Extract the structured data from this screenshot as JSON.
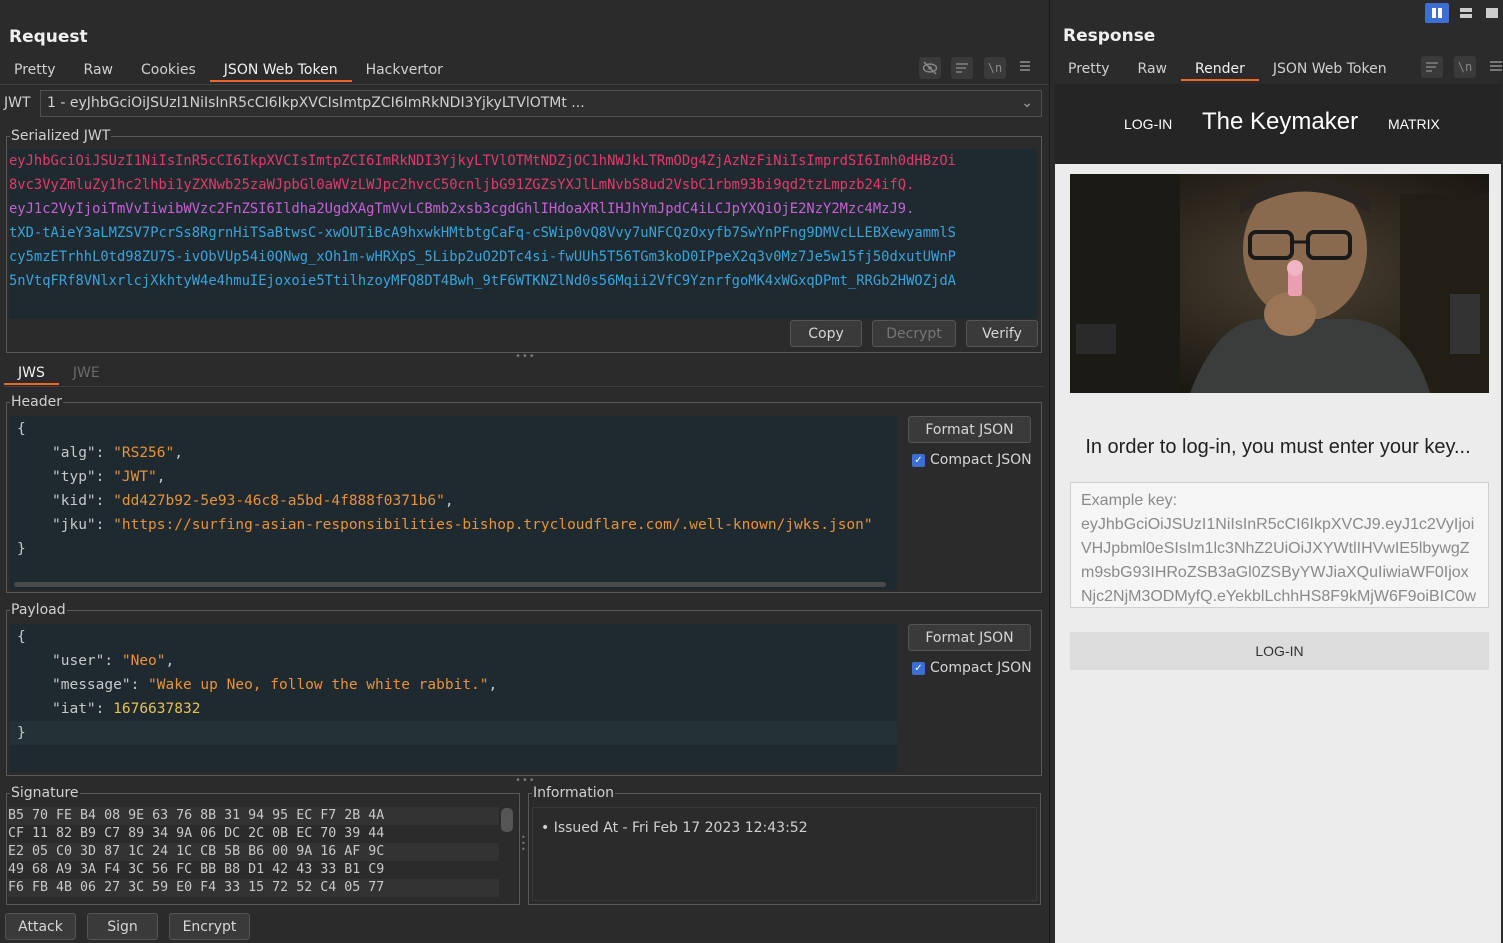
{
  "request": {
    "title": "Request",
    "tabs": [
      "Pretty",
      "Raw",
      "Cookies",
      "JSON Web Token",
      "Hackvertor"
    ],
    "active_tab": "JSON Web Token",
    "jwt_label": "JWT",
    "jwt_select": "1 - eyJhbGciOiJSUzI1NiIsInR5cCI6IkpXVCIsImtpZCI6ImRkNDI3YjkyLTVlOTMt ...",
    "serialized": {
      "legend": "Serialized JWT",
      "lines": [
        "eyJhbGciOiJSUzI1NiIsInR5cCI6IkpXVCIsImtpZCI6ImRkNDI3YjkyLTVlOTMtNDZjOC1hNWJkLTRmODg4ZjAzNzFiNiIsImprdSI6Imh0dHBzOi",
        "8vc3VyZmluZy1hc2lhbi1yZXNwb25zaWJpbGl0aWVzLWJpc2hvcC50cnljbG91ZGZsYXJlLmNvbS8ud2VsbC1rbm93bi9qd2tzLmpzb24ifQ.",
        "eyJ1c2VyIjoiTmVvIiwibWVzc2FnZSI6Ildha2UgdXAgTmVvLCBmb2xsb3cgdGhlIHdoaXRlIHJhYmJpdC4iLCJpYXQiOjE2NzY2Mzc4MzJ9.",
        "tXD-tAieY3aLMZSV7PcrSs8RgrnHiTSaBtwsC-xwOUTiBcA9hxwkHMtbtgCaFq-cSWip0vQ8Vvy7uNFCQzOxyfb7SwYnPFng9DMVcLLEBXewyammlS",
        "cy5mzETrhhL0td98ZU7S-ivObVUp54i0QNwg_xOh1m-wHRXpS_5Libp2uO2DTc4si-fwUUh5T56TGm3koD0IPpeX2q3v0Mz7Je5w15fj50dxutUWnP",
        "5nVtqFRf8VNlxrlcjXkhtyW4e4hmuIEjoxoie5TtilhzoyMFQ8DT4Bwh_9tF6WTKNZlNd0s56Mqii2VfC9YznrfgoMK4xWGxqDPmt_RRGb2HWOZjdA"
      ],
      "line_colors": [
        "#e5396a",
        "#e5396a",
        "#c85fd8",
        "#3aa3dc",
        "#3aa3dc",
        "#3aa3dc"
      ],
      "buttons": [
        "Copy",
        "Decrypt",
        "Verify"
      ]
    },
    "sub_tabs": [
      "JWS",
      "JWE"
    ],
    "header": {
      "legend": "Header",
      "json": {
        "alg": "\"RS256\"",
        "typ": "\"JWT\"",
        "kid": "\"dd427b92-5e93-46c8-a5bd-4f888f0371b6\"",
        "jku": "\"https://surfing-asian-responsibilities-bishop.trycloudflare.com/.well-known/jwks.json\""
      },
      "format_button": "Format JSON",
      "compact_label": "Compact JSON"
    },
    "payload": {
      "legend": "Payload",
      "json": {
        "user": "\"Neo\"",
        "message": "\"Wake up Neo, follow the white rabbit.\"",
        "iat": "1676637832"
      },
      "format_button": "Format JSON",
      "compact_label": "Compact JSON"
    },
    "signature": {
      "legend": "Signature",
      "rows": [
        "B5 70 FE B4 08 9E 63 76 8B 31 94 95 EC F7 2B 4A",
        "CF 11 82 B9 C7 89 34 9A 06 DC 2C 0B EC 70 39 44",
        "E2 05 C0 3D 87 1C 24 1C CB 5B B6 00 9A 16 AF 9C",
        "49 68 A9 3A F4 3C 56 FC BB B8 D1 42 43 33 B1 C9",
        "F6 FB 4B 06 27 3C 59 E0 F4 33 15 72 52 C4 05 77"
      ]
    },
    "information": {
      "legend": "Information",
      "items": [
        "• Issued At - Fri Feb 17 2023 12:43:52"
      ]
    },
    "bottom_buttons": [
      "Attack",
      "Sign",
      "Encrypt"
    ]
  },
  "response": {
    "title": "Response",
    "tabs": [
      "Pretty",
      "Raw",
      "Render",
      "JSON Web Token"
    ],
    "active_tab": "Render",
    "render": {
      "nav_login": "LOG-IN",
      "brand": "The Keymaker",
      "nav_matrix": "MATRIX",
      "prompt": "In order to log-in, you must enter your key...",
      "key_lines": [
        "Example key:",
        "eyJhbGciOiJSUzI1NiIsInR5cCI6IkpXVCJ9.eyJ1c2VyIjoi",
        "VHJpbml0eSIsIm1lc3NhZ2UiOiJXYWtlIHVwIE5lbywgZ",
        "m9sbG93IHRoZSB3aGl0ZSByYWJiaXQuIiwiaWF0Ijox",
        "Njc2NjM3ODMyfQ.eYekblLchhHS8F9kMjW6F9oiBIC0w"
      ],
      "login_button": "LOG-IN"
    }
  }
}
